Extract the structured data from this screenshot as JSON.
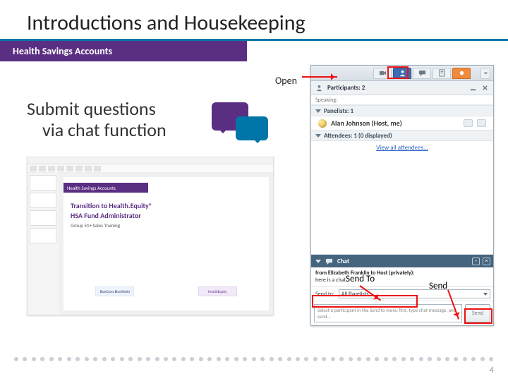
{
  "title": "Introductions and Housekeeping",
  "subtitle": "Health Savings Accounts",
  "open_label": "Open",
  "big_text_l1": "Submit questions",
  "big_text_l2": "via chat function",
  "preso": {
    "bar": "Health Savings Accounts",
    "line1": "Transition to Health.Equity®",
    "line2": "HSA Fund Administrator",
    "line3": "Group 51+ Sales Training",
    "logo1": "BlueCross BlueShield",
    "logo2": "HealthEquity"
  },
  "panel": {
    "participants_label": "Participants: 2",
    "speaking_label": "Speaking:",
    "panelists_header": "Panelists: 1",
    "panelist_name": "Alan Johnson (Host, me)",
    "attendees_header": "Attendees: 1 (0 displayed)",
    "view_all": "View all attendees...",
    "chat_header": "Chat",
    "chat_from": "from Elizabeth Franklin to Host (privately):",
    "chat_msg": "here is a chat",
    "sendto_label": "Send to:",
    "sendto_value": "All Panelists",
    "msg_placeholder": "Select a participant in the Send to menu first, type chat message, and send...",
    "send_btn": "Send"
  },
  "callouts": {
    "sendto": "Send To",
    "send": "Send"
  },
  "page_number": "4"
}
